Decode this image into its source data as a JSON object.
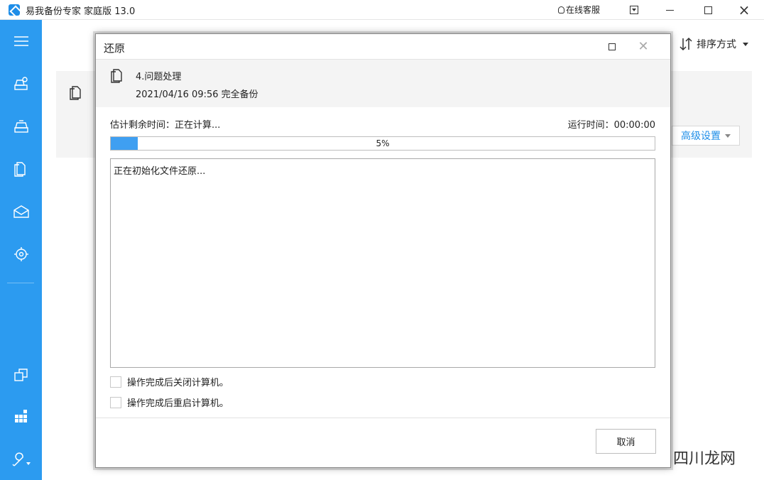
{
  "titlebar": {
    "title": "易我备份专家 家庭版 13.0",
    "online_service": "在线客服"
  },
  "main": {
    "sort_label": "排序方式",
    "advanced_settings": "高级设置"
  },
  "dialog": {
    "title": "还原",
    "backup_name": "4.问题处理",
    "backup_info": "2021/04/16 09:56 完全备份",
    "remaining_label": "估计剩余时间：",
    "remaining_value": "正在计算...",
    "run_label": "运行时间：",
    "run_value": "00:00:00",
    "progress_percent": 5,
    "progress_text": "5%",
    "log_text": "正在初始化文件还原...",
    "option_shutdown": "操作完成后关闭计算机。",
    "option_restart": "操作完成后重启计算机。",
    "cancel_label": "取消"
  },
  "watermark": "四川龙网",
  "colors": {
    "sidebar": "#2c9bf0",
    "progress": "#3f9ff1",
    "accent": "#1f8ee8"
  }
}
